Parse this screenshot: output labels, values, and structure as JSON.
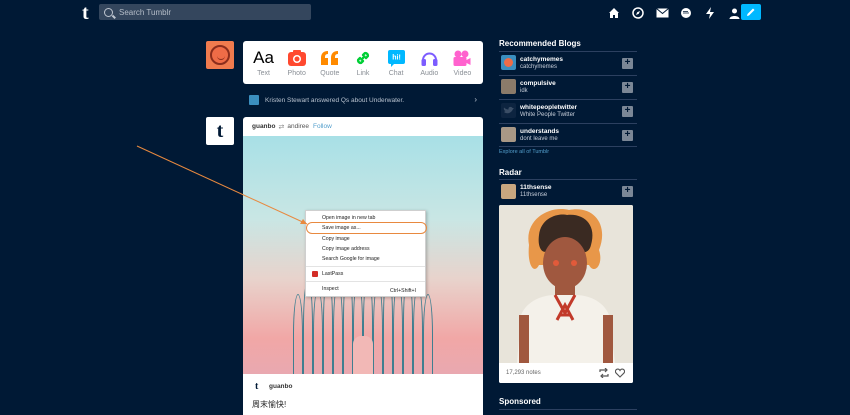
{
  "header": {
    "search_placeholder": "Search Tumblr",
    "logo": "t",
    "icons": [
      "home-icon",
      "explore-icon",
      "inbox-icon",
      "messages-icon",
      "activity-icon",
      "account-icon"
    ],
    "compose_icon": "pencil-icon"
  },
  "post_types": [
    {
      "label": "Text",
      "icon": "text-icon",
      "color": "#000000"
    },
    {
      "label": "Photo",
      "icon": "camera-icon",
      "color": "#ff492f"
    },
    {
      "label": "Quote",
      "icon": "quote-icon",
      "color": "#ff8a00"
    },
    {
      "label": "Link",
      "icon": "link-icon",
      "color": "#00cf35"
    },
    {
      "label": "Chat",
      "icon": "chat-icon",
      "color": "#00b8ff"
    },
    {
      "label": "Audio",
      "icon": "headphones-icon",
      "color": "#7c5cff"
    },
    {
      "label": "Video",
      "icon": "video-icon",
      "color": "#ff62ce"
    }
  ],
  "notice": {
    "text": "Kristen Stewart answered Qs about Underwater."
  },
  "post": {
    "author": "guanbo",
    "reblogged_from": "andiree",
    "follow_label": "Follow",
    "footer_author": "guanbo",
    "caption": "周末愉快!"
  },
  "context_menu": {
    "items": [
      {
        "label": "Open image in new tab"
      },
      {
        "label": "Save image as..."
      },
      {
        "label": "Copy image"
      },
      {
        "label": "Copy image address"
      },
      {
        "label": "Search Google for image"
      },
      {
        "label": "LastPass"
      },
      {
        "label": "Inspect",
        "shortcut": "Ctrl+Shift+I"
      }
    ],
    "highlight_color": "#e8893f"
  },
  "recommended": {
    "title": "Recommended Blogs",
    "blogs": [
      {
        "name": "catchymemes",
        "subtitle": "catchymemes"
      },
      {
        "name": "compulsive",
        "subtitle": "idk"
      },
      {
        "name": "whitepeopletwitter",
        "subtitle": "White People Twitter"
      },
      {
        "name": "understands",
        "subtitle": "dont leave me"
      }
    ],
    "explore_label": "Explore all of Tumblr"
  },
  "radar": {
    "title": "Radar",
    "blog_name": "11thsense",
    "blog_subtitle": "11thsense",
    "notes": "17,293 notes"
  },
  "sponsored": {
    "title": "Sponsored"
  },
  "colors": {
    "background": "#001935",
    "accent": "#00b8ff",
    "link": "#529ecc"
  }
}
